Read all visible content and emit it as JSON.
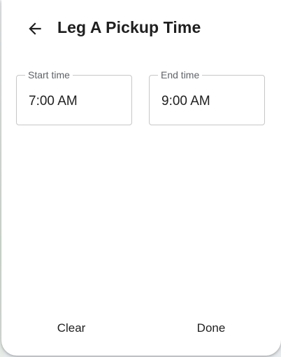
{
  "dialog": {
    "title": "Leg A Pickup Time",
    "back_icon": "arrow-left-icon"
  },
  "fields": {
    "start": {
      "label": "Start time",
      "value": "7:00 AM"
    },
    "end": {
      "label": "End time",
      "value": "9:00 AM"
    }
  },
  "actions": {
    "clear_label": "Clear",
    "done_label": "Done"
  },
  "colors": {
    "text": "#1f1f1f",
    "label": "#5f6368",
    "outline": "#c7c7c7",
    "surface": "#ffffff"
  }
}
